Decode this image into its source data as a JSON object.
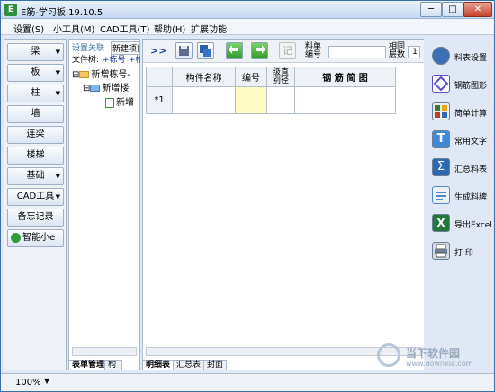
{
  "window": {
    "title": "E筋-学习板 19.10.5",
    "min": "─",
    "max": "□",
    "close": "✕"
  },
  "menu": [
    "设置(S)",
    "小工具(M)",
    "CAD工具(T)",
    "帮助(H)",
    "扩展功能"
  ],
  "left_buttons": [
    {
      "label": "梁",
      "has_arrow": true
    },
    {
      "label": "板",
      "has_arrow": true
    },
    {
      "label": "柱",
      "has_arrow": true
    },
    {
      "label": "墙",
      "has_arrow": false
    },
    {
      "label": "连梁",
      "has_arrow": false
    },
    {
      "label": "楼梯",
      "has_arrow": false
    },
    {
      "label": "基础",
      "has_arrow": true
    },
    {
      "label": "CAD工具",
      "has_arrow": true
    },
    {
      "label": "备忘记录",
      "has_arrow": false
    },
    {
      "label": "智能小e",
      "has_arrow": false
    }
  ],
  "tree_panel": {
    "settings_link": "设置关联",
    "new_item": "新建项目",
    "file_tree_label": "文件树:",
    "add_building": "+栋号",
    "add_floor": "+楼",
    "nodes": [
      "新增栋号-",
      "新增楼",
      "新增"
    ],
    "tabs": [
      "表单管理",
      "构件"
    ]
  },
  "toolbar": {
    "expand": ">>",
    "disabled_label": "记",
    "list_no_label": "料单\n编号",
    "same_floor_label": "相同\n层数",
    "same_floor_value": "1",
    "list_no_value": ""
  },
  "grid": {
    "headers": [
      "构件名称",
      "编号",
      "级直\n别径",
      "钢 筋 简 图"
    ],
    "row_marker": "*1",
    "tabs": [
      "明细表",
      "汇总表",
      "封面"
    ]
  },
  "right_tools": [
    {
      "label": "料表设置",
      "icon": "gear-icon",
      "color": "#3c6fb5"
    },
    {
      "label": "钢筋图形",
      "icon": "diamond-icon",
      "color": "#5a4fc9"
    },
    {
      "label": "简单计算",
      "icon": "calculator-icon",
      "color": "#3b7a2e"
    },
    {
      "label": "常用文字",
      "icon": "text-t-icon",
      "color": "#3e8ad6"
    },
    {
      "label": "汇总料表",
      "icon": "sigma-icon",
      "color": "#2b69b3"
    },
    {
      "label": "生成料牌",
      "icon": "card-icon",
      "color": "#4f88c9"
    },
    {
      "label": "导出Excel",
      "icon": "excel-icon",
      "color": "#1f7a3a"
    },
    {
      "label": "打 印",
      "icon": "printer-icon",
      "color": "#6b7f99"
    }
  ],
  "status": {
    "zoom": "100%"
  },
  "watermark": {
    "text": "当下软件园",
    "url": "www.downxia.com"
  }
}
